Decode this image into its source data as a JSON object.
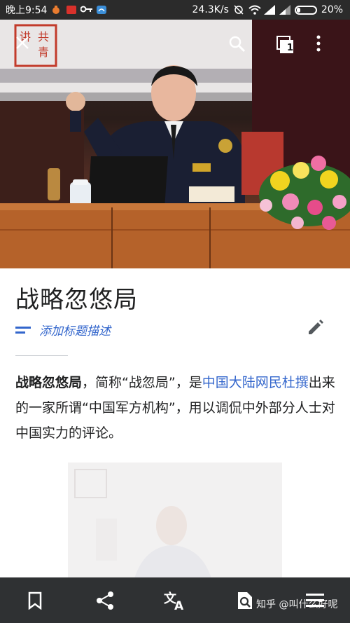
{
  "status_bar": {
    "time": "晚上9:54",
    "net_speed": "24.3K/s",
    "battery_percent": "20%",
    "icons": [
      "notification-icon",
      "app-badge-icon",
      "key-icon",
      "cloud-icon",
      "alarm-off-icon",
      "wifi-icon",
      "signal-icon",
      "signal-icon",
      "battery-icon"
    ]
  },
  "hero": {
    "tabs_count": "1",
    "banner_text": "讲共青",
    "icons": [
      "close-icon",
      "search-icon",
      "tabs-icon",
      "more-icon"
    ]
  },
  "article": {
    "title": "战略忽悠局",
    "add_description": "添加标题描述",
    "para_bold": "战略忽悠局",
    "para_text_1": "，简称“战忽局”，是",
    "para_link": "中国大陆网民杜撰",
    "para_text_2": "出来的一家所谓“中国军方机构”，用以调侃中外部分人士对中国实力的评论。"
  },
  "bottom_bar": {
    "items": [
      "bookmark-icon",
      "share-icon",
      "translate-icon",
      "find-in-page-icon",
      "contents-icon"
    ],
    "watermark": "知乎 @叫什么好呢"
  },
  "colors": {
    "link": "#3366cc",
    "text": "#202122",
    "bottom_bar": "#2f3133",
    "status_bar": "#2b2b2b"
  }
}
